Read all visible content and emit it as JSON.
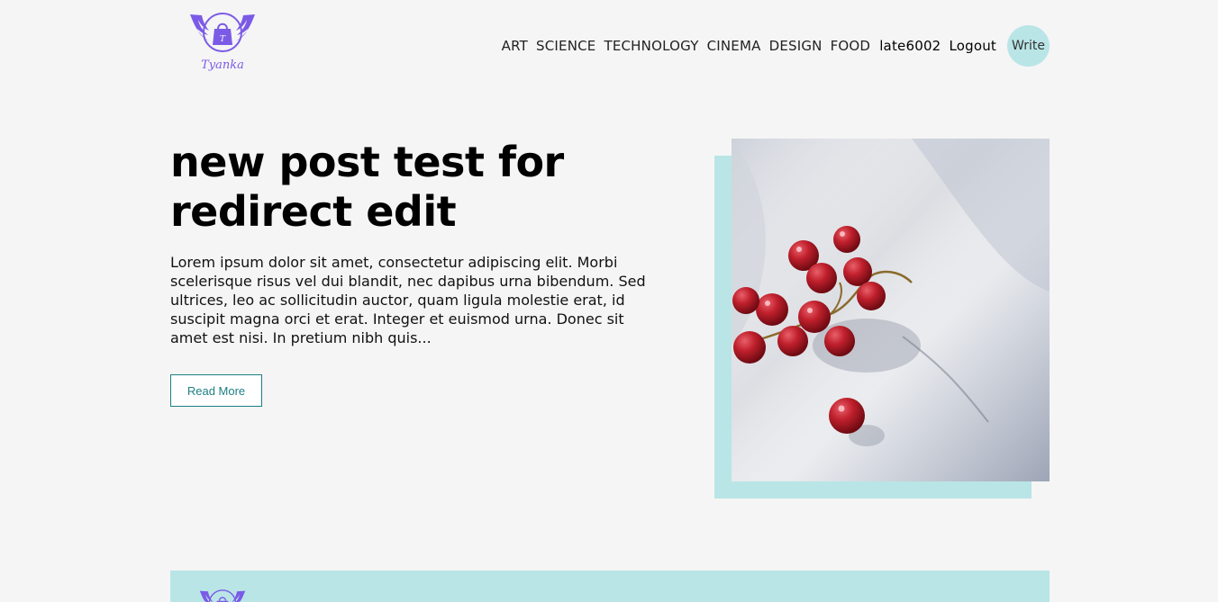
{
  "brand": {
    "name": "Tyanka",
    "accent_color": "#7b5be6",
    "highlight_color": "#b9e5e7"
  },
  "nav": {
    "links": [
      "ART",
      "SCIENCE",
      "TECHNOLOGY",
      "CINEMA",
      "DESIGN",
      "FOOD"
    ],
    "username": "late6002",
    "logout_label": "Logout",
    "write_label": "Write"
  },
  "post": {
    "title": "new post test for redirect edit",
    "excerpt": "Lorem ipsum dolor sit amet, consectetur adipiscing elit. Morbi scelerisque risus vel dui blandit, nec dapibus urna bibendum. Sed ultrices, leo ac sollicitudin auctor, quam ligula molestie erat, id suscipit magna orci et erat. Integer et euismod urna. Donec sit amet est nisi. In pretium nibh quis...",
    "read_more_label": "Read More",
    "image_subject": "red grapes on white surface"
  },
  "footer": {
    "logo_icon": "shopping-bag-wings-logo"
  }
}
